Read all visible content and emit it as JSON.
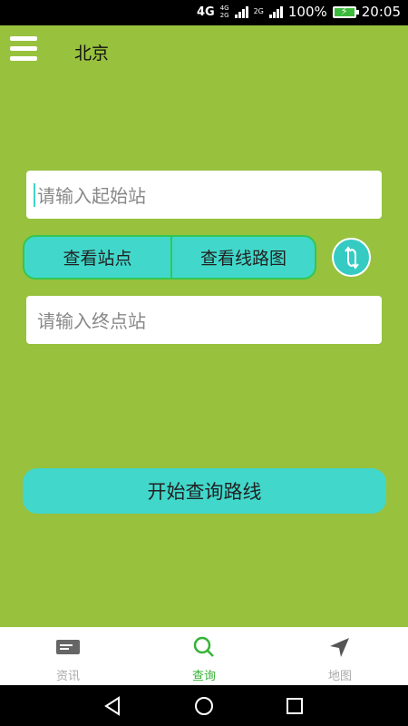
{
  "status_bar": {
    "network": "4G",
    "network_small_top": "4G",
    "network_small_bottom": "2G",
    "network2": "2G",
    "battery_percent": "100%",
    "time": "20:05"
  },
  "header": {
    "city": "北京"
  },
  "form": {
    "start_placeholder": "请输入起始站",
    "end_placeholder": "请输入终点站",
    "view_stations_label": "查看站点",
    "view_route_map_label": "查看线路图",
    "query_label": "开始查询路线"
  },
  "tabs": [
    {
      "label": "资讯",
      "icon": "news-icon",
      "active": false
    },
    {
      "label": "查询",
      "icon": "search-icon",
      "active": true
    },
    {
      "label": "地图",
      "icon": "navigation-icon",
      "active": false
    }
  ],
  "colors": {
    "background": "#98c13d",
    "button": "#41d8cb",
    "active_tab": "#35b235"
  }
}
